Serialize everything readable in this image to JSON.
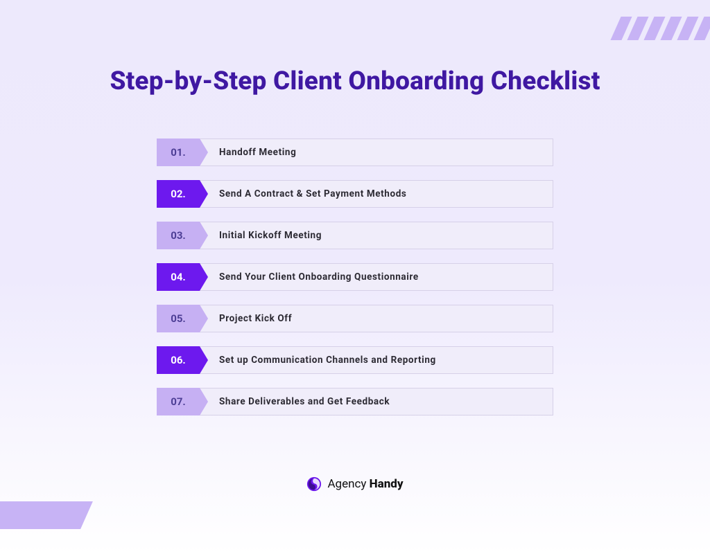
{
  "title": "Step-by-Step Client Onboarding Checklist",
  "steps": [
    {
      "num": "01.",
      "label": "Handoff Meeting"
    },
    {
      "num": "02.",
      "label": "Send A Contract & Set Payment Methods"
    },
    {
      "num": "03.",
      "label": "Initial Kickoff Meeting"
    },
    {
      "num": "04.",
      "label": "Send Your Client Onboarding Questionnaire"
    },
    {
      "num": "05.",
      "label": "Project Kick Off"
    },
    {
      "num": "06.",
      "label": "Set up Communication Channels and Reporting"
    },
    {
      "num": "07.",
      "label": "Share Deliverables and Get Feedback"
    }
  ],
  "brand": {
    "first": "Agency ",
    "second": "Handy"
  },
  "colors": {
    "title": "#3f18a2",
    "badge_light": "#c6b0f3",
    "badge_dark": "#6d19ee"
  }
}
